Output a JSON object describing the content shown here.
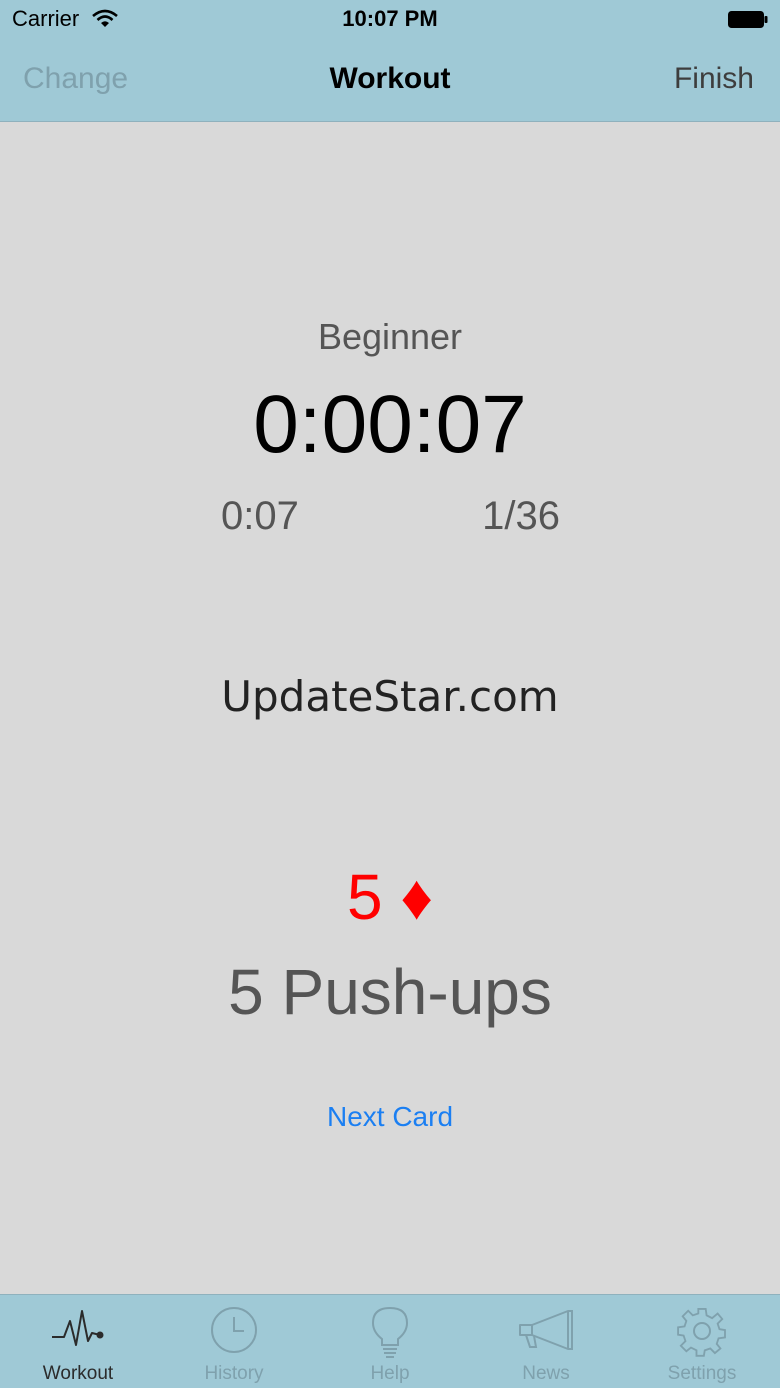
{
  "status": {
    "carrier": "Carrier",
    "time": "10:07 PM"
  },
  "nav": {
    "left": "Change",
    "title": "Workout",
    "right": "Finish"
  },
  "workout": {
    "level": "Beginner",
    "timer": "0:00:07",
    "lap_time": "0:07",
    "card_count": "1/36",
    "ad_text": "UpdateStar.com",
    "card": "5 ♦",
    "exercise": "5 Push-ups",
    "next_card_label": "Next Card"
  },
  "tabs": [
    {
      "label": "Workout",
      "icon": "heartbeat-icon",
      "active": true
    },
    {
      "label": "History",
      "icon": "clock-icon",
      "active": false
    },
    {
      "label": "Help",
      "icon": "lightbulb-icon",
      "active": false
    },
    {
      "label": "News",
      "icon": "megaphone-icon",
      "active": false
    },
    {
      "label": "Settings",
      "icon": "gear-icon",
      "active": false
    }
  ],
  "colors": {
    "bar": "#9fc9d6",
    "background": "#d9d9d9",
    "card_red": "#ff0000",
    "link_blue": "#1b7ff2"
  }
}
